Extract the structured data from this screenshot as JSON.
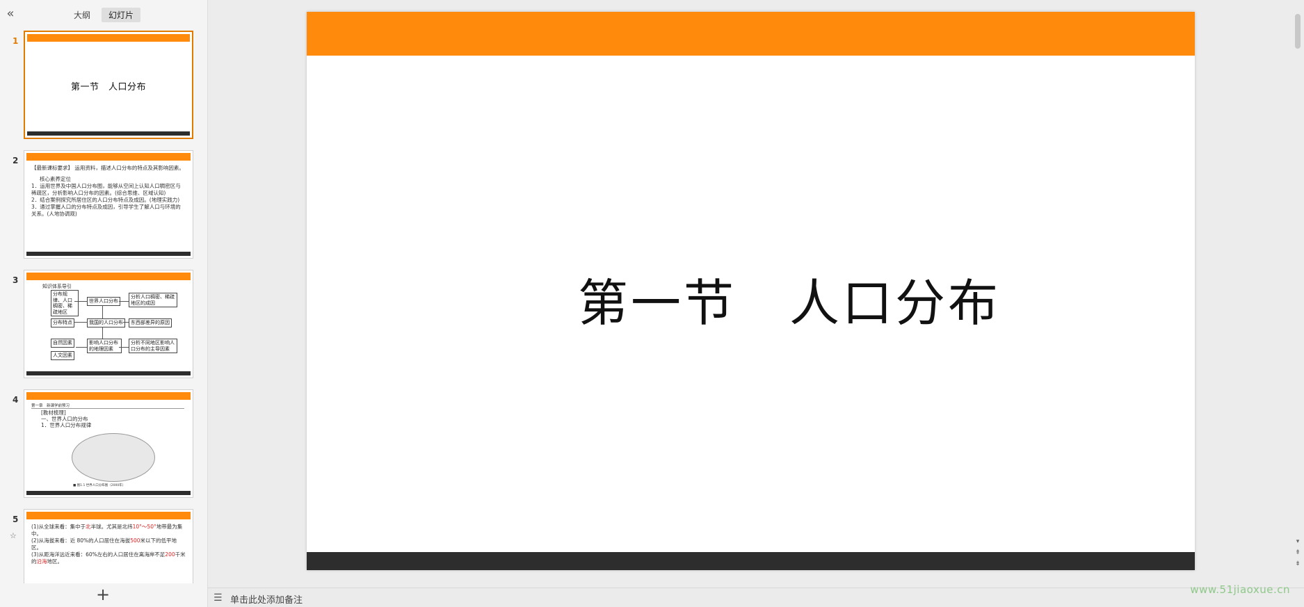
{
  "sidebar": {
    "collapse_icon": "double-chevron-left-icon",
    "collapse_glyph": "«",
    "tabs": [
      {
        "label": "大纲"
      },
      {
        "label": "幻灯片"
      }
    ],
    "slides": [
      {
        "number": "1",
        "title": "第一节　人口分布"
      },
      {
        "number": "2",
        "lines": [
          "【最新课标要求】 运用资料，描述人口分布的特点及其影响因素。",
          "核心素养定位",
          "1．运用世界及中国人口分布图，能够从空间上认知人口稠密区与稀疏区，分析影响人口分布的因素。(综合思维、区域认知)",
          "2．结合案例探究所居住区的人口分布特点及成因。(地理实践力)",
          "3．通过掌握人口的分布特点及成因，引导学生了解人口与环境的关系。(人地协调观)"
        ]
      },
      {
        "number": "3",
        "diagram": {
          "heading": "知识体系导引",
          "left": [
            "分布规律、人口稠密、稀疏地区",
            "分布特点",
            "自然因素",
            "人文因素"
          ],
          "center": [
            "世界人口分布",
            "我国的人口分布",
            "影响人口分布的地理因素"
          ],
          "right": [
            "分析人口稠密、稀疏地区的成因",
            "东西部差异的原因",
            "分析不同地区影响人口分布的主导因素"
          ]
        }
      },
      {
        "number": "4",
        "header_left": "第一章　新课学前预习",
        "lines": [
          "[教材梳理]",
          "一、世界人口的分布",
          "1．世界人口分布规律"
        ],
        "map_caption": "■ 图1.1 世界人口分布图（2000年）"
      },
      {
        "number": "5",
        "star": "☆",
        "lines": [
          [
            "(1)从全球来看：集中于",
            "北",
            "半球。尤其是北纬",
            "10°～50°",
            "地带最为集中。"
          ],
          [
            "(2)从海拔来看：近 80%的人口居住在海拔",
            "500",
            "米以下的低平地区。"
          ],
          [
            "(3)从距海洋远近来看：60%左右的人口居住在离海岸不足",
            "200",
            "千米的",
            "沿海",
            "地区。"
          ]
        ]
      }
    ],
    "add_icon": "plus-icon",
    "add_glyph": "+"
  },
  "main": {
    "slide_title": "第一节　人口分布"
  },
  "notes": {
    "icon": "notes-lines-icon",
    "glyph": "☰",
    "placeholder": "单击此处添加备注"
  },
  "watermark": "www.51jiaoxue.cn",
  "colors": {
    "accent": "#ff8a0c",
    "dark_bar": "#2d2d2d",
    "selection": "#e07b00"
  }
}
